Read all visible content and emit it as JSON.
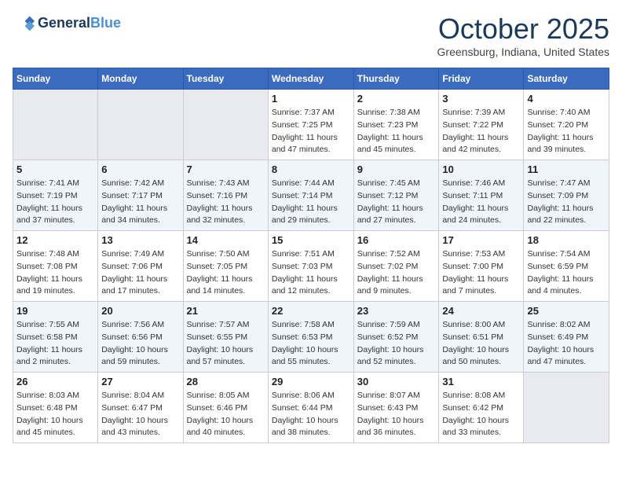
{
  "header": {
    "logo_line1": "General",
    "logo_line2": "Blue",
    "month": "October 2025",
    "location": "Greensburg, Indiana, United States"
  },
  "weekdays": [
    "Sunday",
    "Monday",
    "Tuesday",
    "Wednesday",
    "Thursday",
    "Friday",
    "Saturday"
  ],
  "weeks": [
    [
      {
        "day": "",
        "info": ""
      },
      {
        "day": "",
        "info": ""
      },
      {
        "day": "",
        "info": ""
      },
      {
        "day": "1",
        "info": "Sunrise: 7:37 AM\nSunset: 7:25 PM\nDaylight: 11 hours and 47 minutes."
      },
      {
        "day": "2",
        "info": "Sunrise: 7:38 AM\nSunset: 7:23 PM\nDaylight: 11 hours and 45 minutes."
      },
      {
        "day": "3",
        "info": "Sunrise: 7:39 AM\nSunset: 7:22 PM\nDaylight: 11 hours and 42 minutes."
      },
      {
        "day": "4",
        "info": "Sunrise: 7:40 AM\nSunset: 7:20 PM\nDaylight: 11 hours and 39 minutes."
      }
    ],
    [
      {
        "day": "5",
        "info": "Sunrise: 7:41 AM\nSunset: 7:19 PM\nDaylight: 11 hours and 37 minutes."
      },
      {
        "day": "6",
        "info": "Sunrise: 7:42 AM\nSunset: 7:17 PM\nDaylight: 11 hours and 34 minutes."
      },
      {
        "day": "7",
        "info": "Sunrise: 7:43 AM\nSunset: 7:16 PM\nDaylight: 11 hours and 32 minutes."
      },
      {
        "day": "8",
        "info": "Sunrise: 7:44 AM\nSunset: 7:14 PM\nDaylight: 11 hours and 29 minutes."
      },
      {
        "day": "9",
        "info": "Sunrise: 7:45 AM\nSunset: 7:12 PM\nDaylight: 11 hours and 27 minutes."
      },
      {
        "day": "10",
        "info": "Sunrise: 7:46 AM\nSunset: 7:11 PM\nDaylight: 11 hours and 24 minutes."
      },
      {
        "day": "11",
        "info": "Sunrise: 7:47 AM\nSunset: 7:09 PM\nDaylight: 11 hours and 22 minutes."
      }
    ],
    [
      {
        "day": "12",
        "info": "Sunrise: 7:48 AM\nSunset: 7:08 PM\nDaylight: 11 hours and 19 minutes."
      },
      {
        "day": "13",
        "info": "Sunrise: 7:49 AM\nSunset: 7:06 PM\nDaylight: 11 hours and 17 minutes."
      },
      {
        "day": "14",
        "info": "Sunrise: 7:50 AM\nSunset: 7:05 PM\nDaylight: 11 hours and 14 minutes."
      },
      {
        "day": "15",
        "info": "Sunrise: 7:51 AM\nSunset: 7:03 PM\nDaylight: 11 hours and 12 minutes."
      },
      {
        "day": "16",
        "info": "Sunrise: 7:52 AM\nSunset: 7:02 PM\nDaylight: 11 hours and 9 minutes."
      },
      {
        "day": "17",
        "info": "Sunrise: 7:53 AM\nSunset: 7:00 PM\nDaylight: 11 hours and 7 minutes."
      },
      {
        "day": "18",
        "info": "Sunrise: 7:54 AM\nSunset: 6:59 PM\nDaylight: 11 hours and 4 minutes."
      }
    ],
    [
      {
        "day": "19",
        "info": "Sunrise: 7:55 AM\nSunset: 6:58 PM\nDaylight: 11 hours and 2 minutes."
      },
      {
        "day": "20",
        "info": "Sunrise: 7:56 AM\nSunset: 6:56 PM\nDaylight: 10 hours and 59 minutes."
      },
      {
        "day": "21",
        "info": "Sunrise: 7:57 AM\nSunset: 6:55 PM\nDaylight: 10 hours and 57 minutes."
      },
      {
        "day": "22",
        "info": "Sunrise: 7:58 AM\nSunset: 6:53 PM\nDaylight: 10 hours and 55 minutes."
      },
      {
        "day": "23",
        "info": "Sunrise: 7:59 AM\nSunset: 6:52 PM\nDaylight: 10 hours and 52 minutes."
      },
      {
        "day": "24",
        "info": "Sunrise: 8:00 AM\nSunset: 6:51 PM\nDaylight: 10 hours and 50 minutes."
      },
      {
        "day": "25",
        "info": "Sunrise: 8:02 AM\nSunset: 6:49 PM\nDaylight: 10 hours and 47 minutes."
      }
    ],
    [
      {
        "day": "26",
        "info": "Sunrise: 8:03 AM\nSunset: 6:48 PM\nDaylight: 10 hours and 45 minutes."
      },
      {
        "day": "27",
        "info": "Sunrise: 8:04 AM\nSunset: 6:47 PM\nDaylight: 10 hours and 43 minutes."
      },
      {
        "day": "28",
        "info": "Sunrise: 8:05 AM\nSunset: 6:46 PM\nDaylight: 10 hours and 40 minutes."
      },
      {
        "day": "29",
        "info": "Sunrise: 8:06 AM\nSunset: 6:44 PM\nDaylight: 10 hours and 38 minutes."
      },
      {
        "day": "30",
        "info": "Sunrise: 8:07 AM\nSunset: 6:43 PM\nDaylight: 10 hours and 36 minutes."
      },
      {
        "day": "31",
        "info": "Sunrise: 8:08 AM\nSunset: 6:42 PM\nDaylight: 10 hours and 33 minutes."
      },
      {
        "day": "",
        "info": ""
      }
    ]
  ]
}
